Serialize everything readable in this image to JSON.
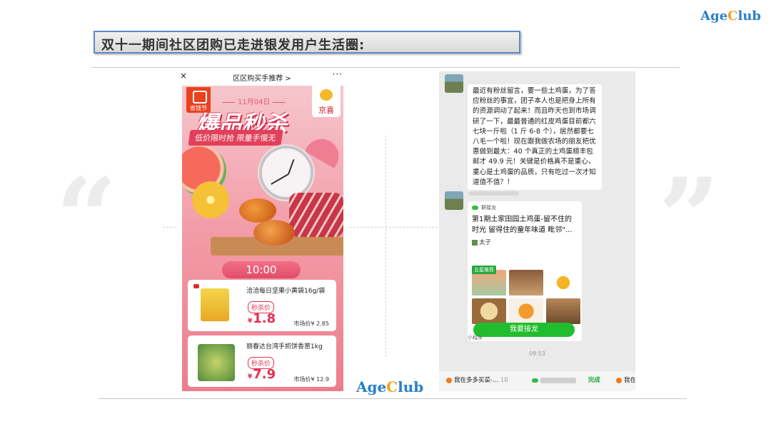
{
  "logo": {
    "c_letter": "C",
    "before": "Age",
    "after": "lub"
  },
  "slide": {
    "title": "双十一期间社区团购已走进银发用户生活圈:"
  },
  "quotes": {
    "open": "“",
    "close": "”"
  },
  "left_phone": {
    "close_icon": "×",
    "title": "区区购买手推荐 >",
    "more_icon": "···",
    "badge_left": "省钱节",
    "badge_right": "京喜",
    "date": "11月04日",
    "headline": "爆品秒杀",
    "subline": "低价限时抢  限量手慢无",
    "time": "10:00",
    "products": [
      {
        "name": "洽洽每日坚果小黄袋16g/袋",
        "tag": "秒杀价",
        "currency": "¥",
        "price": "1.8",
        "market": "市场价¥ 2.85"
      },
      {
        "name": "丽春达台湾手抓饼香葱1kg",
        "tag": "秒杀价",
        "currency": "¥",
        "price": "7.9",
        "market": "市场价¥ 12.9"
      }
    ]
  },
  "right_phone": {
    "message1": "最近有粉丝留言，要一些土鸡蛋，为了答应粉丝的事宜，团子本人也是把身上所有的资源调动了起来！而且昨天也到市场调研了一下，最最普通的红皮鸡蛋目前都六七块一斤啦（1 斤 6-8 个），居然都要七八毛一个啦！现在跟我做农场的朋友把优惠做到最大：40 个真正的土鸡蛋顺丰包邮才 49.9 元！关键是价格真不是重心，重心是土鸡蛋的品质，只有吃过一次才知道值不值？！",
    "card_source": "群接龙",
    "card_title": "第1期土家田园土鸡蛋-留不住的时光 留得住的童年味道 毗邻\"...",
    "card_user": "太子",
    "card_tag": "五星推荐",
    "join_button": "我要接龙",
    "mini_program": "小程序",
    "timestamp": "09:53",
    "bottom_bar": {
      "item1": "我在多多买菜-...",
      "count": "10",
      "done": "完成",
      "item3": "我在"
    }
  }
}
